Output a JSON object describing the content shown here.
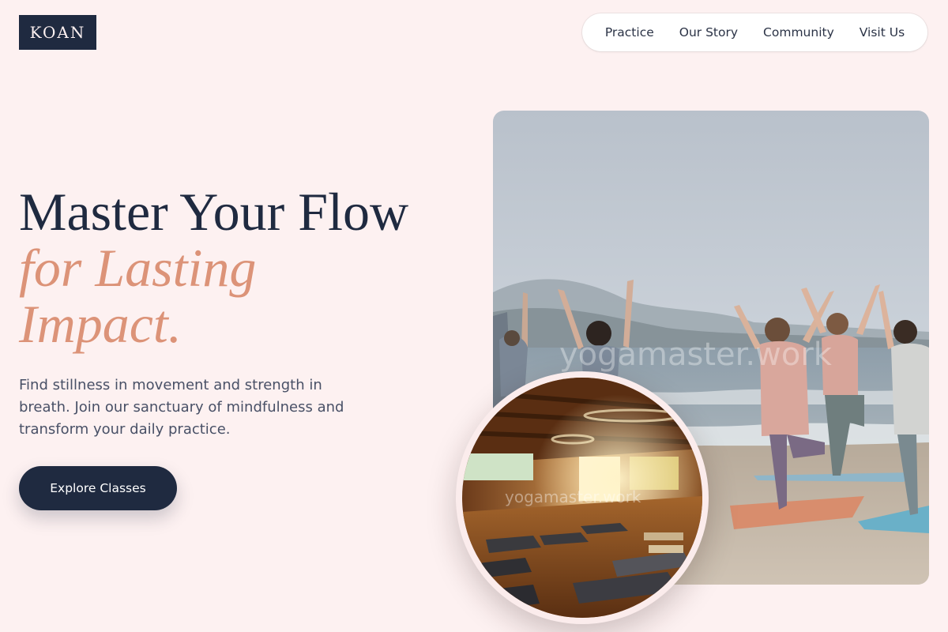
{
  "brand": {
    "logo_text": "KOAN"
  },
  "nav": {
    "items": [
      {
        "label": "Practice"
      },
      {
        "label": "Our Story"
      },
      {
        "label": "Community"
      },
      {
        "label": "Visit Us"
      }
    ]
  },
  "hero": {
    "headline_line1": "Master Your Flow",
    "headline_line2": "for Lasting",
    "headline_line3": "Impact.",
    "subtext": "Find stillness in movement and strength in breath. Join our sanctuary of mindfulness and transform your daily practice.",
    "cta_label": "Explore Classes"
  },
  "images": {
    "main_watermark": "yogamaster.work",
    "studio_watermark": "yogamaster.work"
  },
  "colors": {
    "background": "#fdf1f1",
    "navy": "#1f2a40",
    "accent": "#dc9378"
  }
}
